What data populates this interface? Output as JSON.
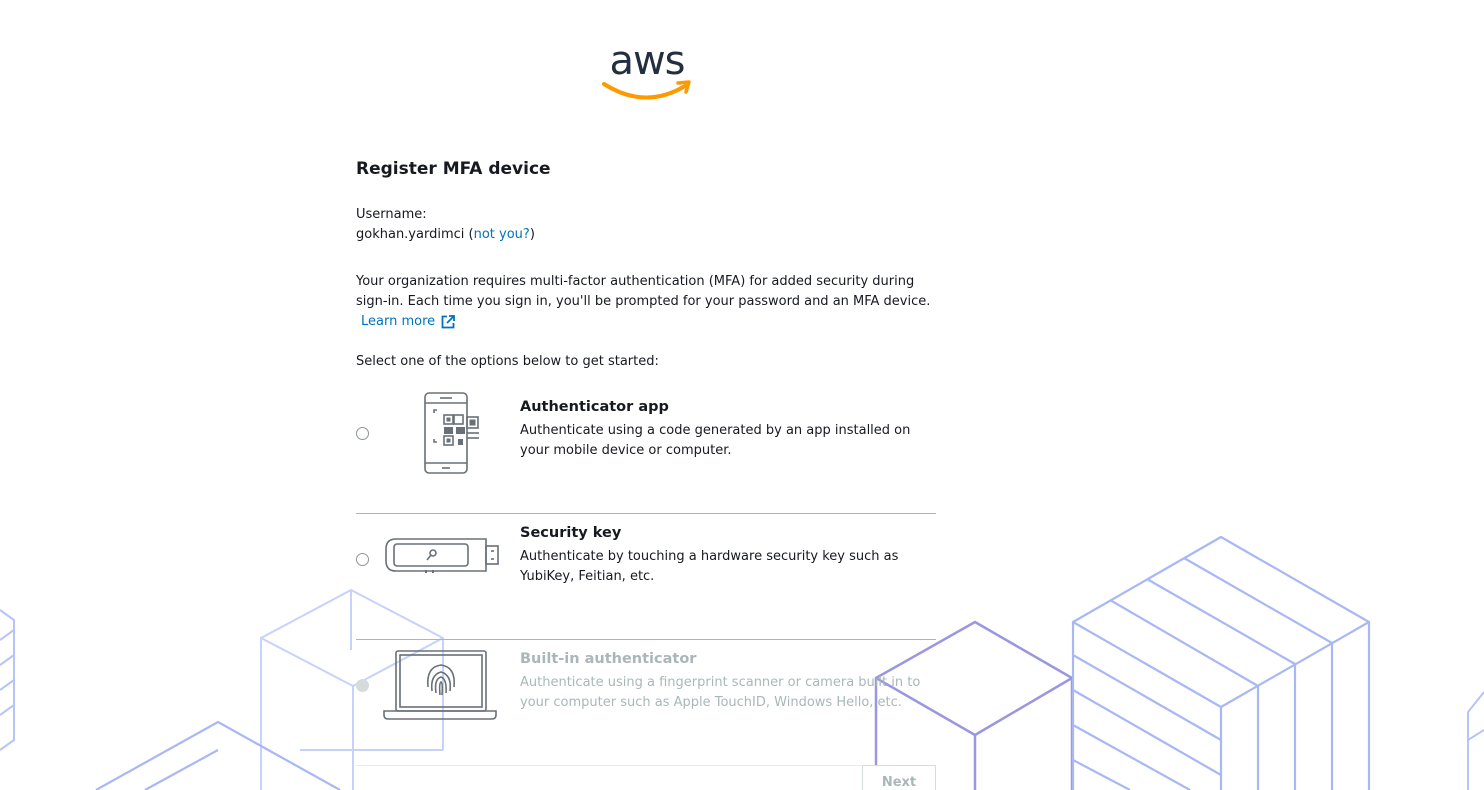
{
  "logo": {
    "text": "aws"
  },
  "title": "Register MFA device",
  "user": {
    "label": "Username:",
    "name": "gokhan.yardimci",
    "not_you_prefix": "(",
    "not_you": "not you?",
    "not_you_suffix": ")"
  },
  "description": "Your organization requires multi-factor authentication (MFA) for added security during sign-in. Each time you sign in, you'll be prompted for your password and an MFA device.",
  "learn_more": "Learn more",
  "select_prompt": "Select one of the options below to get started:",
  "options": [
    {
      "title": "Authenticator app",
      "description": "Authenticate using a code generated by an app installed on your mobile device or computer.",
      "icon": "phone-qr-icon",
      "enabled": true
    },
    {
      "title": "Security key",
      "description": "Authenticate by touching a hardware security key such as YubiKey, Feitian, etc.",
      "icon": "usb-key-icon",
      "enabled": true
    },
    {
      "title": "Built-in authenticator",
      "description": "Authenticate using a fingerprint scanner or camera built in to your computer such as Apple TouchID, Windows Hello, etc.",
      "icon": "laptop-fingerprint-icon",
      "enabled": false
    }
  ],
  "next_button": "Next",
  "colors": {
    "link": "#0073bb",
    "logo_smile": "#ff9900",
    "logo_text": "#232f3e",
    "background_lines": "#a8b8f5"
  }
}
